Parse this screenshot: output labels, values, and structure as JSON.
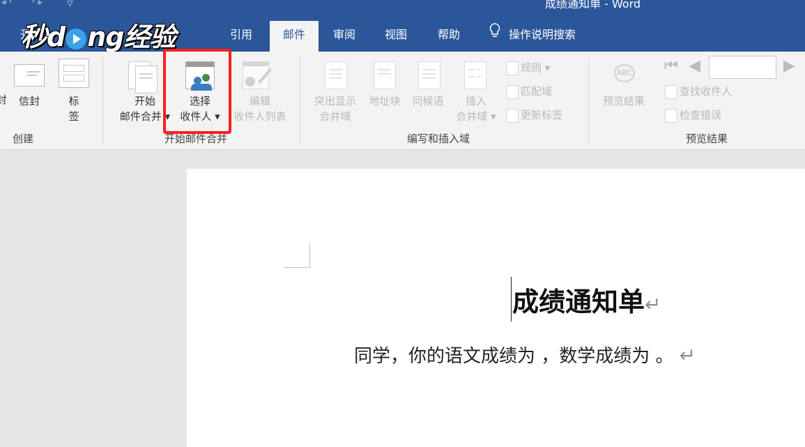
{
  "window": {
    "doc_title": "成绩通知单 - Word",
    "brand_color": "#2b579a",
    "ribbon_bg": "#f3f3f3",
    "highlight_color": "#ff1e1e"
  },
  "watermark": {
    "text_before": "秒d",
    "text_after": "ng经验"
  },
  "tabs": [
    {
      "label": "开",
      "active": false
    },
    {
      "label": "引用",
      "active": false
    },
    {
      "label": "邮件",
      "active": true
    },
    {
      "label": "审阅",
      "active": false
    },
    {
      "label": "视图",
      "active": false
    },
    {
      "label": "帮助",
      "active": false
    },
    {
      "label": "操作说明搜索",
      "active": false,
      "icon": "lightbulb-icon"
    }
  ],
  "ribbon": {
    "create": {
      "label": "创建",
      "envelope_partial": "封",
      "envelope": "信封",
      "labels_line1": "标",
      "labels_line2": "签"
    },
    "start": {
      "label": "开始邮件合并",
      "start_merge_line1": "开始",
      "start_merge_line2": "邮件合并",
      "select_recipients_line1": "选择",
      "select_recipients_line2": "收件人",
      "edit_list_line1": "编辑",
      "edit_list_line2": "收件人列表"
    },
    "write": {
      "label": "编写和插入域",
      "highlight_line1": "突出显示",
      "highlight_line2": "合并域",
      "address_block": "地址块",
      "greeting": "问候语",
      "insert_line1": "插入",
      "insert_line2": "合并域",
      "rules": "规则",
      "match_fields": "匹配域",
      "update_labels": "更新标签"
    },
    "preview": {
      "label": "预览结果",
      "preview_results": "预览结果",
      "find_recipient": "查找收件人",
      "check_errors": "检查错误",
      "record_value": ""
    }
  },
  "document": {
    "heading": "成绩通知单",
    "paragraph": "同学，你的语文成绩为 ，数学成绩为 。",
    "paragraph_mark": "↵"
  }
}
